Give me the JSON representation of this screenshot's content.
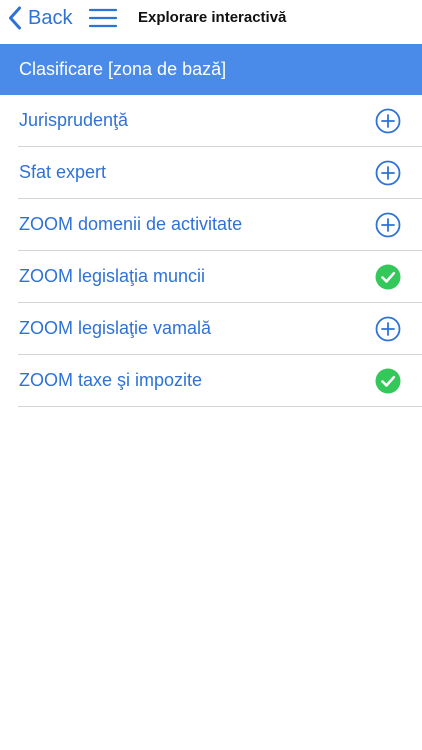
{
  "navbar": {
    "back_label": "Back",
    "title": "Explorare interactivă"
  },
  "section": {
    "title": "Clasificare [zona de bază]"
  },
  "colors": {
    "accent": "#2f72d6",
    "header_bg": "#4a8ae8",
    "check_green": "#34c759"
  },
  "items": [
    {
      "label": "Jurisprudenţă",
      "status": "add",
      "icon": "plus-circle-icon"
    },
    {
      "label": "Sfat expert",
      "status": "add",
      "icon": "plus-circle-icon"
    },
    {
      "label": "ZOOM domenii de activitate",
      "status": "add",
      "icon": "plus-circle-icon"
    },
    {
      "label": "ZOOM legislaţia muncii",
      "status": "added",
      "icon": "check-circle-icon"
    },
    {
      "label": "ZOOM legislaţie vamală",
      "status": "add",
      "icon": "plus-circle-icon"
    },
    {
      "label": "ZOOM taxe şi impozite",
      "status": "added",
      "icon": "check-circle-icon"
    }
  ]
}
